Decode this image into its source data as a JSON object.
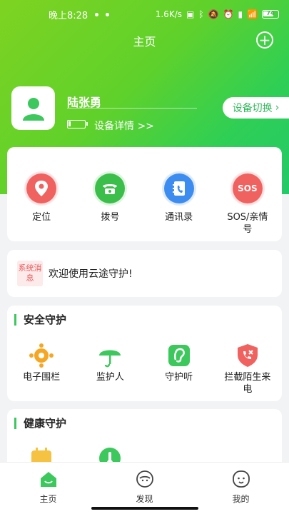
{
  "status_bar": {
    "time": "晚上8:28",
    "net_speed": "1.6K/s",
    "battery_level": "74"
  },
  "header": {
    "title": "主页"
  },
  "profile": {
    "name": "陆张勇",
    "device_detail": "设备详情 >>",
    "switch_device": "设备切换",
    "device_battery_level": 0.15
  },
  "quick_actions": [
    {
      "label": "定位",
      "icon": "location-pin-icon",
      "color": "#f0625f"
    },
    {
      "label": "拨号",
      "icon": "telephone-icon",
      "color": "#3cbf4a"
    },
    {
      "label": "通讯录",
      "icon": "contacts-book-icon",
      "color": "#3d8df0"
    },
    {
      "label": "SOS/亲情号",
      "icon": "sos-icon",
      "color": "#f0625f"
    }
  ],
  "notice": {
    "tag": "系统消息",
    "text": "欢迎使用云途守护!"
  },
  "safety": {
    "title": "安全守护",
    "items": [
      {
        "label": "电子围栏",
        "icon": "geofence-icon",
        "color": "#f5a623"
      },
      {
        "label": "监护人",
        "icon": "umbrella-icon",
        "color": "#3cc85c"
      },
      {
        "label": "守护听",
        "icon": "ear-icon",
        "color": "#3cc85c"
      },
      {
        "label": "拦截陌生来电",
        "icon": "block-call-icon",
        "color": "#f0625f"
      }
    ]
  },
  "health": {
    "title": "健康守护",
    "items": [
      {
        "icon": "step-calendar-icon",
        "color": "#f5c242"
      },
      {
        "icon": "thermometer-icon",
        "color": "#3cc85c"
      }
    ]
  },
  "tabbar": [
    {
      "label": "主页",
      "icon": "home-icon",
      "active": true
    },
    {
      "label": "发现",
      "icon": "discover-icon",
      "active": false
    },
    {
      "label": "我的",
      "icon": "profile-face-icon",
      "active": false
    }
  ]
}
